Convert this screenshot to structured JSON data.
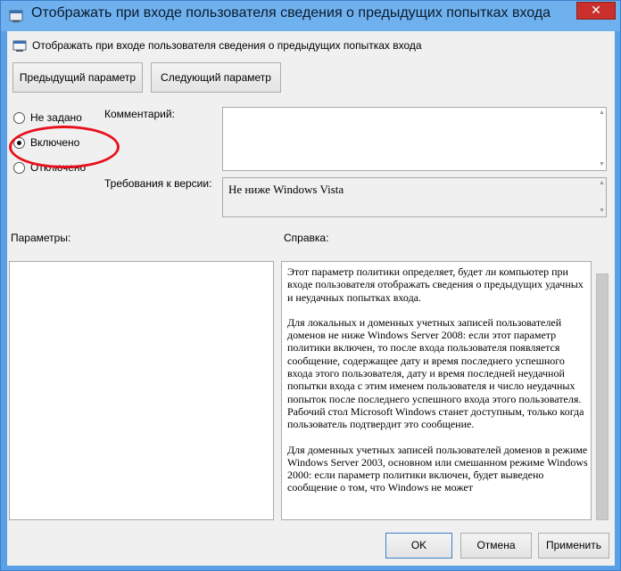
{
  "window": {
    "title": "Отображать при входе пользователя сведения о предыдущих попытках входа",
    "close_glyph": "✕"
  },
  "header": {
    "policy_name": "Отображать при входе пользователя сведения о предыдущих попытках входа"
  },
  "nav": {
    "prev_label": "Предыдущий параметр",
    "next_label": "Следующий параметр"
  },
  "state": {
    "options": [
      {
        "label": "Не задано",
        "checked": false
      },
      {
        "label": "Включено",
        "checked": true
      },
      {
        "label": "Отключено",
        "checked": false
      }
    ]
  },
  "comment": {
    "label": "Комментарий:",
    "value": ""
  },
  "requirements": {
    "label": "Требования к версии:",
    "value": "Не ниже Windows Vista"
  },
  "panels": {
    "params_label": "Параметры:",
    "help_label": "Справка:"
  },
  "help": {
    "paragraphs": [
      "Этот параметр политики определяет, будет ли компьютер при входе пользователя отображать сведения о предыдущих удачных и неудачных попытках входа.",
      "Для локальных и доменных учетных записей пользователей доменов не ниже Windows Server 2008: если этот параметр политики включен, то после входа пользователя появляется сообщение, содержащее дату и время последнего успешного входа этого пользователя, дату и время последней неудачной попытки входа с этим именем пользователя и число неудачных попыток после последнего успешного входа этого пользователя. Рабочий стол Microsoft Windows станет доступным, только когда пользователь подтвердит это сообщение.",
      "Для доменных учетных записей пользователей доменов в режиме Windows Server 2003, основном или смешанном режиме Windows 2000: если параметр политики включен, будет выведено сообщение о том, что Windows не может"
    ]
  },
  "footer": {
    "ok_label": "OK",
    "cancel_label": "Отмена",
    "apply_label": "Применить"
  },
  "colors": {
    "title_bar": "#6fb1ef",
    "annotation": "#e8101c",
    "close_button": "#c9302c"
  }
}
